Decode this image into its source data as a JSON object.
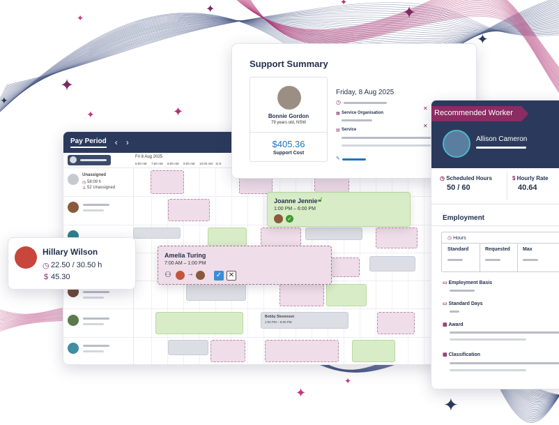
{
  "colors": {
    "navy": "#2b3a5c",
    "plum": "#7b2b62",
    "ribbon": "#8b2c63",
    "shift_pink": "#efdde9",
    "shift_green": "#d8ecc8",
    "shift_grey": "#dcdee5",
    "link_blue": "#1b74c8",
    "checkbox_blue": "#3a8ed8"
  },
  "roster": {
    "tab_label": "Pay Period",
    "prev_icon": "chevron-left-icon",
    "next_icon": "chevron-right-icon",
    "date": "Fri 8 Aug 2025",
    "times": [
      "6:00 AM",
      "7:00 AM",
      "8:00 AM",
      "9:00 AM",
      "10:00 AM",
      "11:0"
    ],
    "unassigned": {
      "title": "Unassigned",
      "hours": "58:09 h",
      "count": "52 Unassigned"
    },
    "bobby": {
      "name": "Bobby Stevenson",
      "time": "1:00 PM – 6:00 PM"
    }
  },
  "joanne": {
    "name": "Joanne Jennie",
    "time": "1:00 PM – 6:00 PM"
  },
  "amelia": {
    "name": "Amelia Turing",
    "time": "7:00 AM – 1:00 PM",
    "close_icon": "close-icon",
    "confirm_icon": "checkbox-icon"
  },
  "hillary": {
    "name": "Hillary Wilson",
    "hours": "22.50 / 30.50 h",
    "rate": "45.30"
  },
  "support": {
    "title": "Support Summary",
    "client_name": "Bonnie Gordon",
    "client_meta": "79 years old, NSW",
    "cost": "$405.36",
    "cost_label": "Support Cost",
    "date": "Friday, 8 Aug 2025",
    "service_org_label": "Service Organisation",
    "service_label": "Service"
  },
  "worker": {
    "ribbon": "Recommended Worker",
    "name": "Allison Cameron",
    "scheduled_label": "Scheduled Hours",
    "scheduled_value": "50 / 60",
    "rate_label": "Hourly Rate",
    "rate_value": "40.64",
    "employment_title": "Employment",
    "hours_label": "Hours",
    "columns": [
      "Standard",
      "Requested",
      "Max"
    ],
    "sections": [
      "Employment Basis",
      "Standard Days",
      "Award",
      "Classification"
    ]
  }
}
